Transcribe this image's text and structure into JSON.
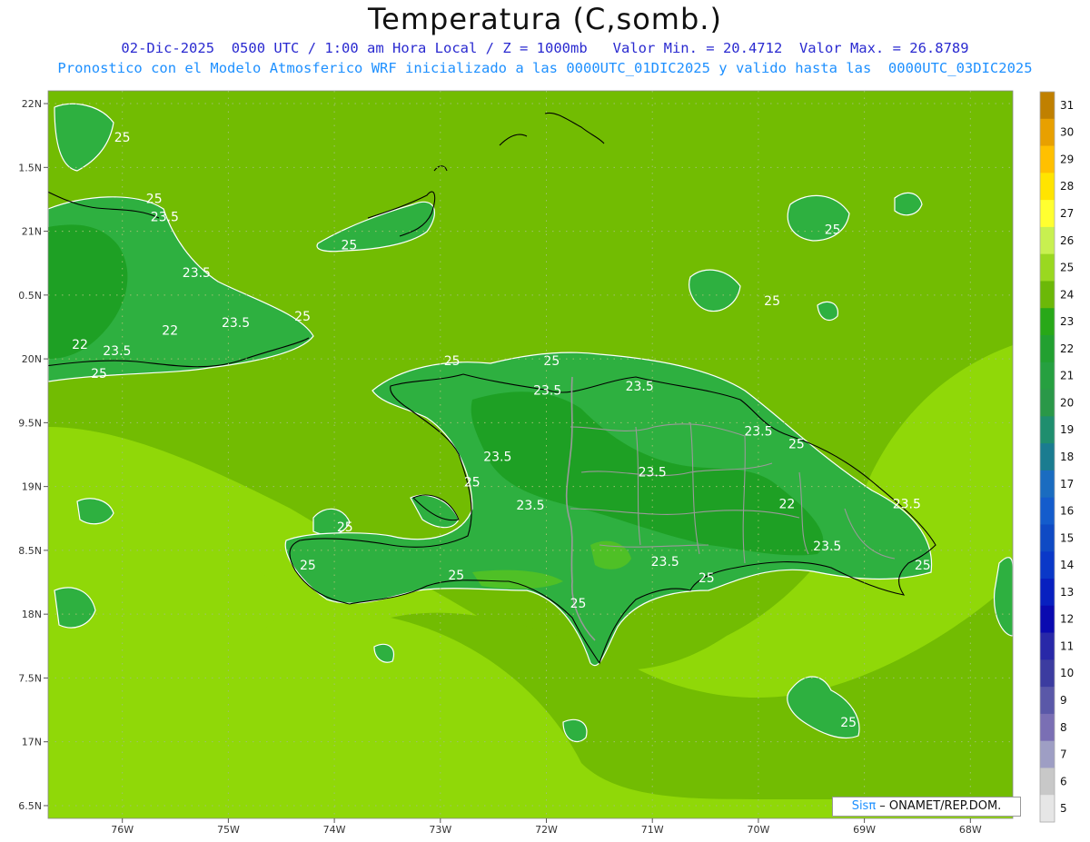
{
  "header": {
    "title": "Temperatura (C,somb.)",
    "line1": "02-Dic-2025  0500 UTC / 1:00 am Hora Local / Z = 1000mb   Valor Min. = 20.4712  Valor Max. = 26.8789",
    "line2": "Pronostico con el Modelo Atmosferico WRF inicializado a las 0000UTC_01DIC2025 y valido hasta las  0000UTC_03DIC2025"
  },
  "map": {
    "lon_range": [
      -76.7,
      -67.6
    ],
    "lat_range": [
      16.4,
      22.1
    ],
    "lat_ticks": [
      {
        "v": 22,
        "label": "22N"
      },
      {
        "v": 21.5,
        "label": "1.5N"
      },
      {
        "v": 21,
        "label": "21N"
      },
      {
        "v": 20.5,
        "label": "0.5N"
      },
      {
        "v": 20,
        "label": "20N"
      },
      {
        "v": 19.5,
        "label": "9.5N"
      },
      {
        "v": 19,
        "label": "19N"
      },
      {
        "v": 18.5,
        "label": "8.5N"
      },
      {
        "v": 18,
        "label": "18N"
      },
      {
        "v": 17.5,
        "label": "7.5N"
      },
      {
        "v": 17,
        "label": "17N"
      },
      {
        "v": 16.5,
        "label": "6.5N"
      }
    ],
    "lon_ticks": [
      {
        "v": -76,
        "label": "76W"
      },
      {
        "v": -75,
        "label": "75W"
      },
      {
        "v": -74,
        "label": "74W"
      },
      {
        "v": -73,
        "label": "73W"
      },
      {
        "v": -72,
        "label": "72W"
      },
      {
        "v": -71,
        "label": "71W"
      },
      {
        "v": -70,
        "label": "70W"
      },
      {
        "v": -69,
        "label": "69W"
      },
      {
        "v": -68,
        "label": "68W"
      }
    ],
    "contour_labels": [
      {
        "text": "25",
        "lon": -76.0,
        "lat": 21.7
      },
      {
        "text": "23.5",
        "lon": -75.6,
        "lat": 21.08
      },
      {
        "text": "25",
        "lon": -75.7,
        "lat": 21.22
      },
      {
        "text": "23.5",
        "lon": -75.3,
        "lat": 20.64
      },
      {
        "text": "23.5",
        "lon": -74.93,
        "lat": 20.25
      },
      {
        "text": "22",
        "lon": -75.55,
        "lat": 20.19
      },
      {
        "text": "25",
        "lon": -74.3,
        "lat": 20.3
      },
      {
        "text": "22",
        "lon": -76.4,
        "lat": 20.08
      },
      {
        "text": "23.5",
        "lon": -76.05,
        "lat": 20.03
      },
      {
        "text": "25",
        "lon": -76.22,
        "lat": 19.85
      },
      {
        "text": "25",
        "lon": -73.86,
        "lat": 20.86
      },
      {
        "text": "25",
        "lon": -72.89,
        "lat": 19.95
      },
      {
        "text": "25",
        "lon": -71.95,
        "lat": 19.95
      },
      {
        "text": "23.5",
        "lon": -71.99,
        "lat": 19.72
      },
      {
        "text": "23.5",
        "lon": -72.46,
        "lat": 19.2
      },
      {
        "text": "25",
        "lon": -72.7,
        "lat": 19.0
      },
      {
        "text": "23.5",
        "lon": -71.12,
        "lat": 19.75
      },
      {
        "text": "23.5",
        "lon": -70.0,
        "lat": 19.4
      },
      {
        "text": "25",
        "lon": -69.64,
        "lat": 19.3
      },
      {
        "text": "23.5",
        "lon": -71.0,
        "lat": 19.08
      },
      {
        "text": "22",
        "lon": -69.73,
        "lat": 18.83
      },
      {
        "text": "23.5",
        "lon": -68.6,
        "lat": 18.83
      },
      {
        "text": "23.5",
        "lon": -72.15,
        "lat": 18.82
      },
      {
        "text": "23.5",
        "lon": -69.35,
        "lat": 18.5
      },
      {
        "text": "25",
        "lon": -73.9,
        "lat": 18.65
      },
      {
        "text": "25",
        "lon": -74.25,
        "lat": 18.35
      },
      {
        "text": "25",
        "lon": -72.85,
        "lat": 18.27
      },
      {
        "text": "23.5",
        "lon": -70.88,
        "lat": 18.38
      },
      {
        "text": "25",
        "lon": -70.49,
        "lat": 18.25
      },
      {
        "text": "25",
        "lon": -68.45,
        "lat": 18.35
      },
      {
        "text": "25",
        "lon": -71.7,
        "lat": 18.05
      },
      {
        "text": "25",
        "lon": -69.3,
        "lat": 20.98
      },
      {
        "text": "25",
        "lon": -69.87,
        "lat": 20.42
      },
      {
        "text": "25",
        "lon": -69.15,
        "lat": 17.12
      }
    ]
  },
  "colorbar": {
    "labels": [
      "31",
      "30",
      "29",
      "28",
      "27",
      "26",
      "25",
      "24",
      "23",
      "22",
      "21",
      "20",
      "19",
      "18",
      "17",
      "16",
      "15",
      "14",
      "13",
      "12",
      "11",
      "10",
      "9",
      "8",
      "7",
      "6",
      "5"
    ],
    "colors": [
      "#c08000",
      "#e8a000",
      "#ffc000",
      "#ffe400",
      "#ffff30",
      "#c8f050",
      "#9ad820",
      "#6cb808",
      "#28a818",
      "#22a030",
      "#26a040",
      "#2a9848",
      "#1f8e6e",
      "#1a7c90",
      "#1a6cc0",
      "#145ccc",
      "#0f4ac4",
      "#0a38c8",
      "#0820c0",
      "#0a0ab0",
      "#2828a8",
      "#3c3ca0",
      "#5a58a8",
      "#7a6fb4",
      "#9e9ec4",
      "#c8c8c8",
      "#e6e6e6"
    ]
  },
  "fill_colors": {
    "sea_light": "#90d808",
    "sea_mid": "#72bc02",
    "land_dark": "#1ea024",
    "land_mid": "#2eb040",
    "land_light": "#4fc026"
  },
  "credit": {
    "sis": "Sisπ",
    "rest": " – ONAMET/REP.DOM."
  }
}
